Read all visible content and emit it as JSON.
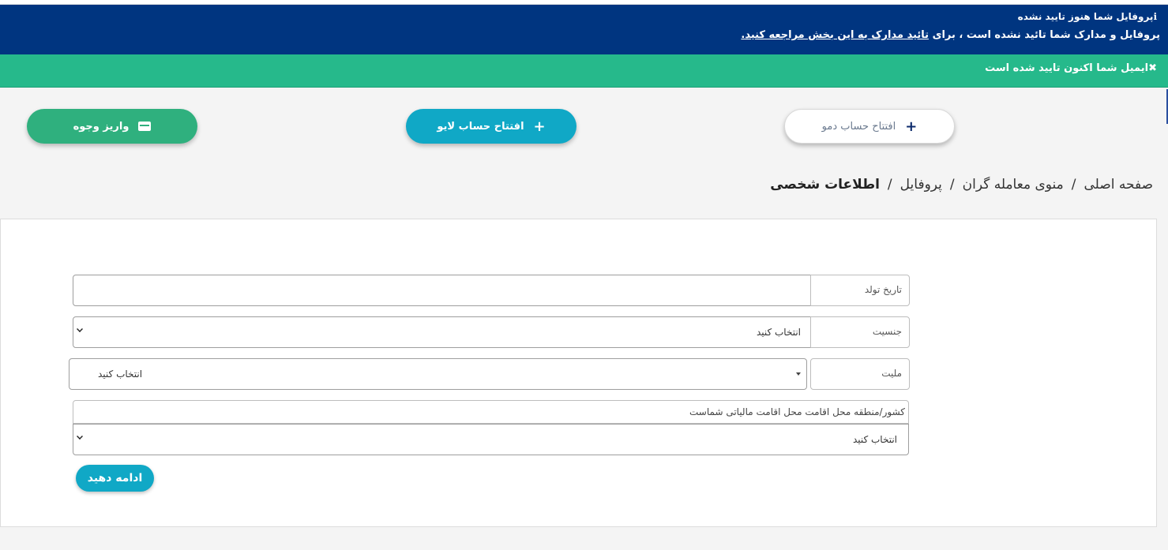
{
  "alerts": {
    "profile_unverified": {
      "title": "پروفایل شما هنوز تایید نشده",
      "message_prefix": "پروفایل و مدارک شما تائید نشده است ، برای",
      "message_link": "تائید مدارک به این بخش مراجعه کنید.",
      "color": "#003580"
    },
    "email_verified": {
      "message": "ایمیل شما اکنون تایید شده است",
      "close": "✖",
      "color": "#26b98b"
    }
  },
  "actions": {
    "open_demo": "افتتاح حساب دمو",
    "open_live": "افتتاح حساب لایو",
    "deposit": "واریز وجوه",
    "plus": "+"
  },
  "breadcrumb": {
    "items": [
      "صفحه اصلی",
      "منوی معامله گران",
      "پروفایل"
    ],
    "current": "اطلاعات شخصی",
    "separator": "/"
  },
  "form": {
    "birth_date": {
      "label": "تاریخ تولد",
      "value": ""
    },
    "gender": {
      "label": "جنسیت",
      "value": "انتخاب کنید"
    },
    "nationality": {
      "label": "ملیت",
      "value": "انتخاب کنید"
    },
    "tax_residence": {
      "label": "کشور/منطقه محل اقامت محل اقامت مالیاتی شماست",
      "value": "انتخاب کنید"
    },
    "continue": "ادامه دهید"
  },
  "colors": {
    "primary": "#10a8c6",
    "success": "#2fb07e",
    "navy": "#003580"
  }
}
